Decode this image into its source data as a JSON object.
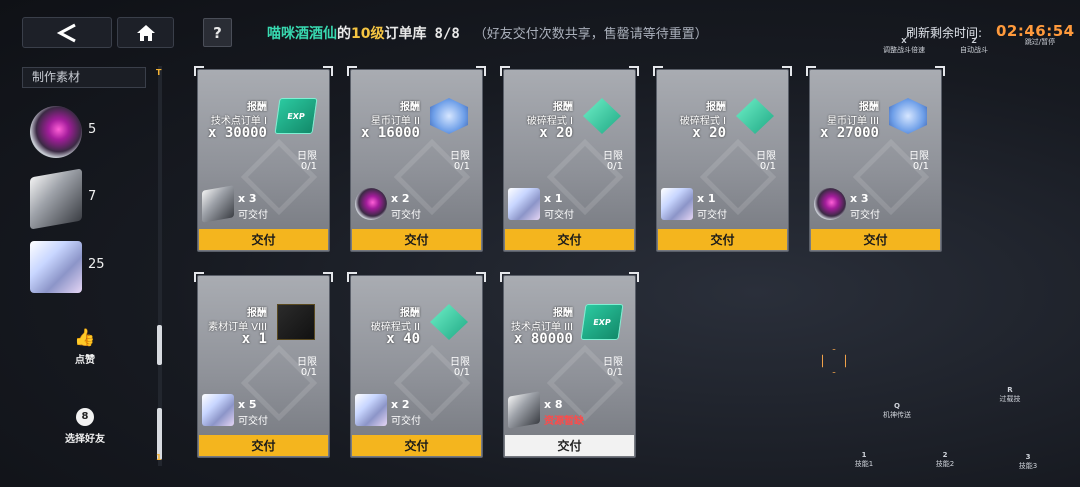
{
  "header": {
    "back_icon": "chevron-left-icon",
    "home_icon": "home-icon",
    "help_label": "?",
    "shop_name": "喵咪酒酒仙",
    "of_text": "的",
    "level_text": "10级",
    "library_text": "订单库",
    "order_count": "8/8",
    "note": "（好友交付次数共享，售罄请等待重置）",
    "refresh_label": "刷新剩余时间:",
    "refresh_time": "02:46:54"
  },
  "hud_hints": [
    {
      "key": "X",
      "label": "调整战斗倍速"
    },
    {
      "key": "Z",
      "label": "自动战斗"
    },
    {
      "key": "",
      "label": "跳过/暂停"
    },
    {
      "key": "Q",
      "label": "机神传送"
    },
    {
      "key": "R",
      "label": "过载技"
    },
    {
      "key": "1",
      "label": "技能1"
    },
    {
      "key": "2",
      "label": "技能2"
    },
    {
      "key": "3",
      "label": "技能3"
    }
  ],
  "sidebar": {
    "title": "制作素材",
    "materials": [
      {
        "icon": "orb-material-icon",
        "count": "5"
      },
      {
        "icon": "chip-material-icon",
        "count": "7"
      },
      {
        "icon": "cube-material-icon",
        "count": "25"
      }
    ],
    "top_marker": "T",
    "bottom_marker": "1",
    "like_label": "点赞",
    "friend_label": "选择好友",
    "friend_icon_text": "8"
  },
  "common": {
    "reward_label": "报酬",
    "day_label": "日限",
    "deliverable": "可交付",
    "shortage": "资源暂缺",
    "deliver": "交付"
  },
  "orders": [
    {
      "name": "技术点订单 I",
      "amount": "x 30000",
      "reward_icon": "exp-icon",
      "reward_text": "EXP",
      "day_limit": "0/1",
      "req_icon": "chip-material-icon",
      "req_qty": "x 3",
      "status": "可交付",
      "available": true
    },
    {
      "name": "星币订单 II",
      "amount": "x 16000",
      "reward_icon": "star-coin-icon",
      "reward_text": "",
      "day_limit": "0/1",
      "req_icon": "orb-material-icon",
      "req_qty": "x 2",
      "status": "可交付",
      "available": true
    },
    {
      "name": "破碎程式 I",
      "amount": "x 20",
      "reward_icon": "crack-program-icon",
      "reward_text": "",
      "day_limit": "0/1",
      "req_icon": "cube-material-icon",
      "req_qty": "x 1",
      "status": "可交付",
      "available": true
    },
    {
      "name": "破碎程式 I",
      "amount": "x 20",
      "reward_icon": "crack-program-icon",
      "reward_text": "",
      "day_limit": "0/1",
      "req_icon": "cube-material-icon",
      "req_qty": "x 1",
      "status": "可交付",
      "available": true
    },
    {
      "name": "星币订单 III",
      "amount": "x 27000",
      "reward_icon": "star-coin-icon",
      "reward_text": "",
      "day_limit": "0/1",
      "req_icon": "orb-material-icon",
      "req_qty": "x 3",
      "status": "可交付",
      "available": true
    },
    {
      "name": "素材订单 VIII",
      "amount": "x 1",
      "reward_icon": "material-box-icon",
      "reward_text": "",
      "day_limit": "0/1",
      "req_icon": "cube-material-icon",
      "req_qty": "x 5",
      "status": "可交付",
      "available": true
    },
    {
      "name": "破碎程式 II",
      "amount": "x 40",
      "reward_icon": "crack-program-icon",
      "reward_text": "",
      "day_limit": "0/1",
      "req_icon": "cube-material-icon",
      "req_qty": "x 2",
      "status": "可交付",
      "available": true
    },
    {
      "name": "技术点订单 III",
      "amount": "x 80000",
      "reward_icon": "exp-icon",
      "reward_text": "EXP",
      "day_limit": "0/1",
      "req_icon": "chip-material-icon",
      "req_qty": "x 8",
      "status": "资源暂缺",
      "available": false
    }
  ],
  "colors": {
    "accent_yellow": "#f4b51e",
    "name_green": "#38d9b0",
    "level_gold": "#f5c542",
    "timer_orange": "#ff9a3c",
    "shortage_red": "#ff4a4a"
  }
}
